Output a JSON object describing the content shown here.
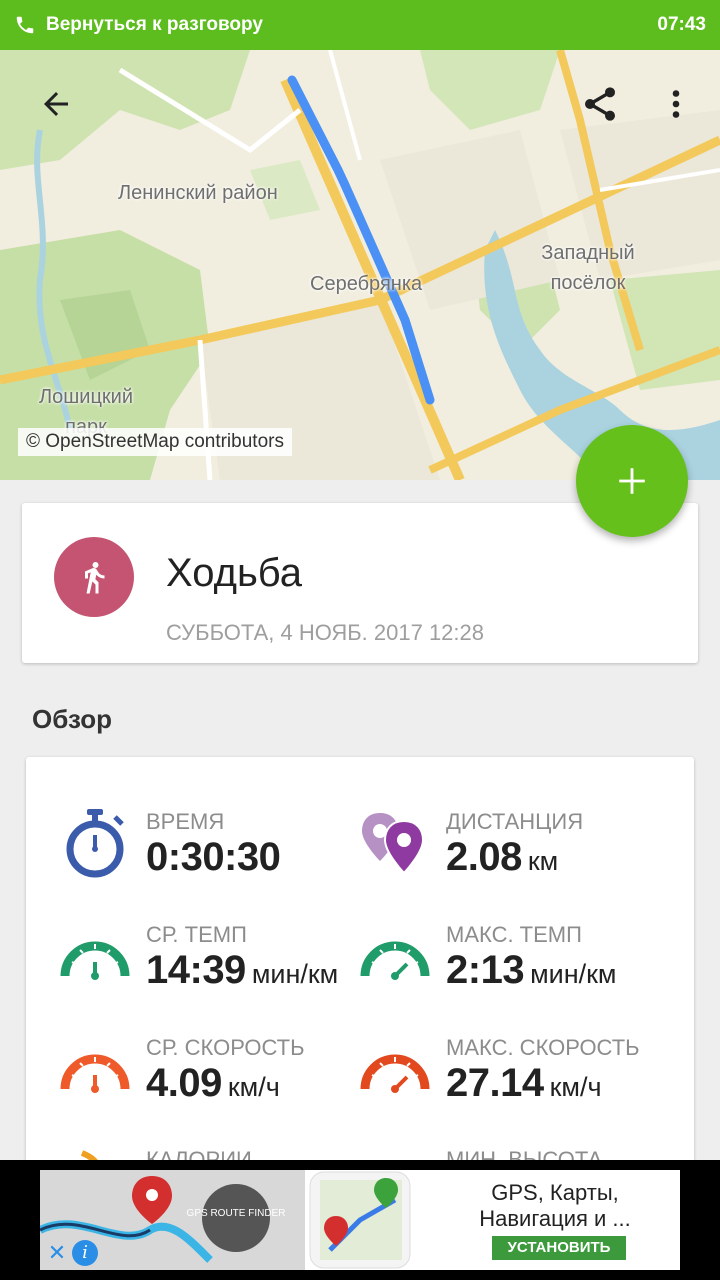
{
  "status_bar": {
    "return_text": "Вернуться к разговору",
    "time": "07:43"
  },
  "map": {
    "labels": [
      "Ленинский район",
      "Серебрянка",
      "Западный посёлок",
      "Лошицкий парк"
    ],
    "credit": "© OpenStreetMap contributors",
    "route_color": "#4a90f5"
  },
  "toolbar": {
    "back_icon": "arrow-back-icon",
    "share_icon": "share-icon",
    "menu_icon": "more-vert-icon"
  },
  "fab": {
    "icon": "plus-icon",
    "color": "#66c01c"
  },
  "activity": {
    "title": "Ходьба",
    "date": "СУББОТА, 4 НОЯБ. 2017 12:28",
    "icon": "walking-icon",
    "icon_color": "#c45471"
  },
  "overview": {
    "title": "Обзор",
    "stats": [
      {
        "label": "ВРЕМЯ",
        "value": "0:30:30",
        "unit": "",
        "icon": "stopwatch-icon"
      },
      {
        "label": "ДИСТАНЦИЯ",
        "value": "2.08",
        "unit": "км",
        "icon": "location-pins-icon"
      },
      {
        "label": "СР. ТЕМП",
        "value": "14:39",
        "unit": "мин/км",
        "icon": "pace-gauge-icon"
      },
      {
        "label": "МАКС. ТЕМП",
        "value": "2:13",
        "unit": "мин/км",
        "icon": "max-pace-gauge-icon"
      },
      {
        "label": "СР. СКОРОСТЬ",
        "value": "4.09",
        "unit": "км/ч",
        "icon": "speed-gauge-icon"
      },
      {
        "label": "МАКС. СКОРОСТЬ",
        "value": "27.14",
        "unit": "км/ч",
        "icon": "max-speed-gauge-icon"
      },
      {
        "label": "КАЛОРИИ",
        "value": "",
        "unit": "",
        "icon": "calories-icon"
      },
      {
        "label": "МИН. ВЫСОТА",
        "value": "",
        "unit": "",
        "icon": "altitude-icon"
      }
    ]
  },
  "ad": {
    "badge": "GPS ROUTE FINDER",
    "text": "GPS, Карты, Навигация и ...",
    "install": "УСТАНОВИТЬ"
  }
}
